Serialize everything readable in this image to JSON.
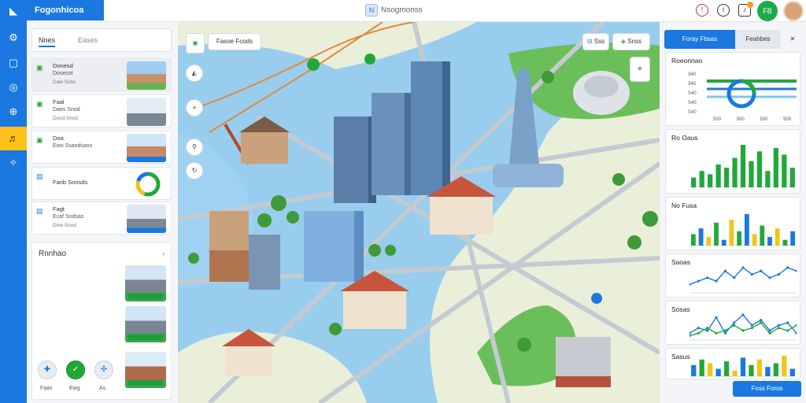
{
  "app": {
    "brand": "Fogonhicoa",
    "title": "Nsogmonss",
    "badge": "N"
  },
  "topbar": {
    "avatar_initials": "FB"
  },
  "left_panel": {
    "tabs": [
      "Nnes",
      "Eases"
    ],
    "cards": [
      {
        "icon": "building-icon",
        "line1": "Donesd",
        "line2": "Dosecot",
        "line3": "Daw Ssbs"
      },
      {
        "icon": "building-icon",
        "line1": "Faal",
        "line2": "Daes Snod",
        "line3": "Dosd Smot"
      },
      {
        "icon": "building-icon",
        "line1": "Doa",
        "line2": "Ewo Ssaodsaos",
        "line3": ""
      },
      {
        "icon": "doc-icon",
        "line1": "Fanb Sonsds",
        "line2": "",
        "line3": ""
      },
      {
        "icon": "doc-icon",
        "line1": "Fagt",
        "line2": "Ecaf Sndsas",
        "line3": "Dow Sood"
      }
    ],
    "section": {
      "title": "Rnnhao"
    },
    "actions": [
      {
        "icon": "pin-icon",
        "label": "Faas"
      },
      {
        "icon": "check-icon",
        "label": "Ewg"
      },
      {
        "icon": "share-icon",
        "label": "As"
      }
    ]
  },
  "map": {
    "search_label": "Fasoe Fcods",
    "filter_label": "Sss",
    "layers_label": "Snss"
  },
  "right_panel": {
    "tabs": [
      "Foray Fbsas",
      "Feahbes"
    ],
    "cards": [
      {
        "title": "Roeonnao",
        "ticks": [
          "340",
          "340",
          "S40",
          "S40",
          "S40"
        ],
        "xticks": [
          "500",
          "500",
          "500",
          "500"
        ]
      },
      {
        "title": "Ro Oaus"
      },
      {
        "title": "No Fusa"
      },
      {
        "title": "Saoas"
      },
      {
        "title": "Sosas"
      },
      {
        "title": "Sasus"
      }
    ],
    "cta": "Foss Foros"
  },
  "chart_data": [
    {
      "type": "bar",
      "title": "Ro Oaus",
      "values": [
        3,
        5,
        4,
        7,
        6,
        9,
        13,
        8,
        11,
        5,
        12,
        10,
        6
      ],
      "colors": [
        "#22a83a"
      ]
    },
    {
      "type": "bar",
      "title": "No Fusa",
      "values": [
        4,
        6,
        3,
        8,
        2,
        9,
        5,
        11,
        4,
        7,
        3,
        6,
        2,
        5
      ],
      "colors": [
        "#22a83a",
        "#1a78e0",
        "#f2c41a"
      ]
    },
    {
      "type": "line",
      "title": "Saoas",
      "values": [
        2,
        3,
        4,
        3,
        6,
        4,
        7,
        5,
        6,
        4,
        5,
        7,
        6
      ]
    },
    {
      "type": "line",
      "title": "Sosas",
      "series": [
        {
          "values": [
            2,
            4,
            3,
            8,
            2,
            6,
            9,
            5,
            7,
            3,
            5,
            6,
            2
          ]
        },
        {
          "values": [
            1,
            2,
            4,
            2,
            3,
            5,
            3,
            4,
            6,
            2,
            4,
            3,
            5
          ]
        }
      ]
    },
    {
      "type": "bar",
      "title": "Sasus",
      "values": [
        6,
        9,
        7,
        4,
        8,
        3,
        10,
        6,
        9,
        5,
        7,
        11,
        4
      ],
      "colors": [
        "#1a78e0",
        "#22a83a",
        "#f2c41a"
      ]
    }
  ]
}
